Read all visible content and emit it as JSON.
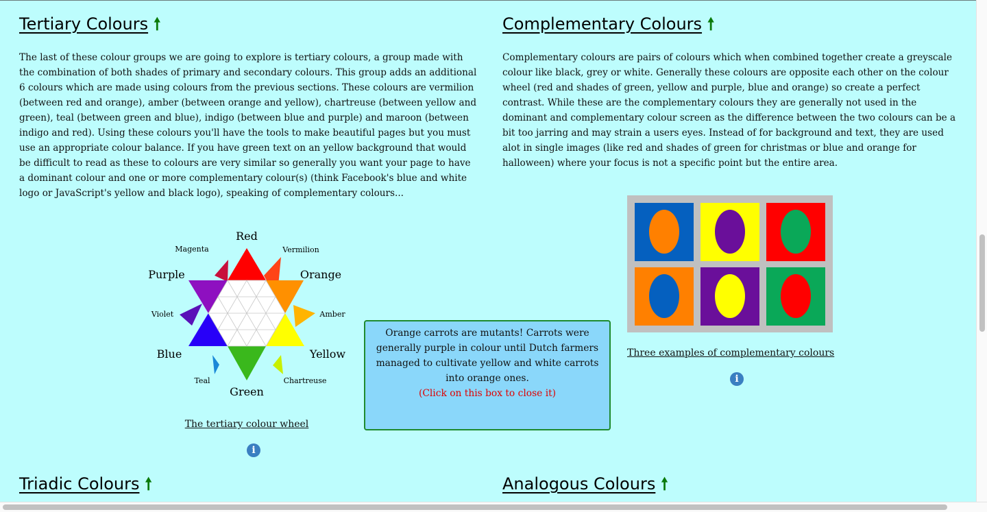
{
  "sections": {
    "tertiary": {
      "title": "Tertiary Colours",
      "arrow": "🠕",
      "body": "The last of these colour groups we are going to explore is tertiary colours, a group made with the combination of both shades of primary and secondary colours. This group adds an additional 6 colours which are made using colours from the previous sections. These colours are vermilion (between red and orange), amber (between orange and yellow), chartreuse (between yellow and green), teal (between green and blue), indigo (between blue and purple) and maroon (between indigo and red). Using these colours you'll have the tools to make beautiful pages but you must use an appropriate colour balance. If you have green text on an yellow background that would be difficult to read as these to colours are very similar so generally you want your page to have a dominant colour and one or more complementary colour(s) (think Facebook's blue and white logo or JavaScript's yellow and black logo), speaking of complementary colours...",
      "caption": "The tertiary colour wheel",
      "info_icon": "i"
    },
    "complementary": {
      "title": "Complementary Colours",
      "arrow": "🠕",
      "body": "Complementary colours are pairs of colours which when combined together create a greyscale colour like black, grey or white. Generally these colours are opposite each other on the colour wheel (red and shades of green, yellow and purple, blue and orange) so create a perfect contrast. While these are the complementary colours they are generally not used in the dominant and complementary colour screen as the difference between the two colours can be a bit too jarring and may strain a users eyes. Instead of for background and text, they are used alot in single images (like red and shades of green for christmas or blue and orange for halloween) where your focus is not a specific point but the entire area.",
      "caption": "Three examples of complementary colours",
      "info_icon": "i"
    },
    "triadic": {
      "title": "Triadic Colours",
      "arrow": "🠕"
    },
    "analogous": {
      "title": "Analogous Colours",
      "arrow": "🠕"
    }
  },
  "wheel_labels": {
    "red": "Red",
    "orange": "Orange",
    "yellow": "Yellow",
    "green": "Green",
    "blue": "Blue",
    "purple": "Purple",
    "magenta": "Magenta",
    "vermilion": "Vermilion",
    "amber": "Amber",
    "chartreuse": "Chartreuse",
    "teal": "Teal",
    "violet": "Violet"
  },
  "callout": {
    "text": "Orange carrots are mutants! Carrots were generally purple in colour until Dutch farmers managed to cultivate yellow and white carrots into orange ones.",
    "close_text": "(Click on this box to close it)"
  },
  "colors": {
    "page_background": "#bdfdfd",
    "heading_arrow": "#0a7a0a",
    "callout_background": "#8ad7fa",
    "callout_border": "#1e8a2e",
    "close_text": "#e00000",
    "info_icon": "#3a7fc1",
    "complementary_pairs": [
      {
        "background": "#0560bf",
        "oval": "#ff8000"
      },
      {
        "background": "#ffff00",
        "oval": "#6a0f9a"
      },
      {
        "background": "#ff0000",
        "oval": "#0aa858"
      },
      {
        "background": "#ff8000",
        "oval": "#0560bf"
      },
      {
        "background": "#6a0f9a",
        "oval": "#ffff00"
      },
      {
        "background": "#0aa858",
        "oval": "#ff0000"
      }
    ]
  }
}
